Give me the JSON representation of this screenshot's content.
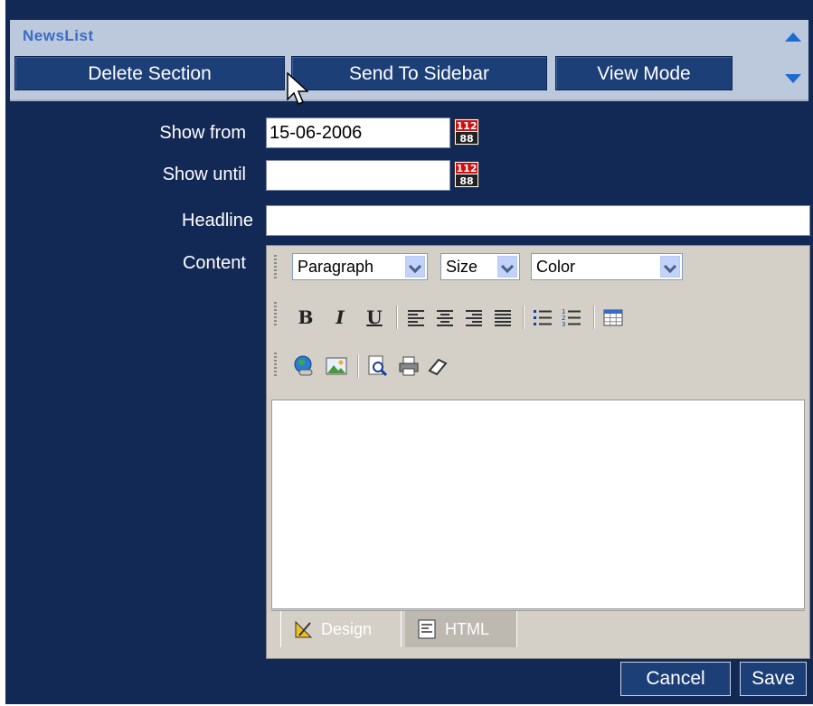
{
  "header": {
    "title": "NewsList",
    "buttons": {
      "delete_section": "Delete Section",
      "send_to_sidebar": "Send To Sidebar",
      "view_mode": "View Mode"
    }
  },
  "form": {
    "show_from": {
      "label": "Show from",
      "value": "15-06-2006"
    },
    "show_until": {
      "label": "Show until",
      "value": ""
    },
    "headline": {
      "label": "Headline",
      "value": ""
    },
    "content": {
      "label": "Content"
    }
  },
  "editor": {
    "paragraph_select": "Paragraph",
    "size_select": "Size",
    "color_select": "Color",
    "bold": "B",
    "italic": "I",
    "underline": "U",
    "tabs": {
      "design": "Design",
      "html": "HTML"
    }
  },
  "footer": {
    "cancel": "Cancel",
    "save": "Save"
  },
  "colors": {
    "background": "#132955",
    "header": "#bcc8dc",
    "button": "#1d3f78",
    "title": "#3a6bc5",
    "toolbar": "#d4d0c8"
  }
}
